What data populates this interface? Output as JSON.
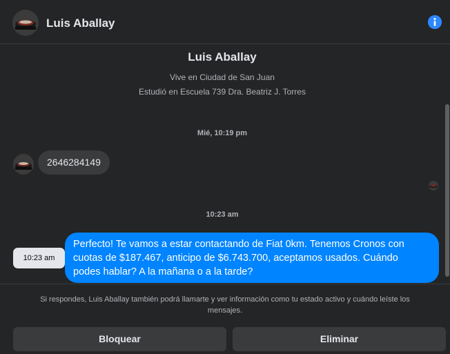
{
  "header": {
    "name": "Luis Aballay",
    "avatar_icon": "profile-photo",
    "info_icon": "info-icon"
  },
  "profile": {
    "name": "Luis Aballay",
    "lives_in": "Vive en Ciudad de San Juan",
    "studied_at": "Estudió en Escuela 739 Dra. Beatriz J. Torres"
  },
  "messages": {
    "timestamp_1": "Mié, 10:19 pm",
    "incoming_text": "2646284149",
    "timestamp_2": "10:23 am",
    "outgoing_line_1": "Perfecto! Te vamos a estar contactando de Fiat 0km. Tenemos Cronos con",
    "outgoing_line_2": "cuotas de $187.467, anticipo de $6.743.700, aceptamos usados. Cuándo",
    "outgoing_line_3": "podes hablar? A la mañana o a la tarde?",
    "outgoing_time_tooltip": "10:23 am"
  },
  "footer": {
    "notice_line_1": "Si respondes, Luis Aballay también podrá llamarte y ver información como tu estado activo y cuándo leíste los",
    "notice_line_2": "mensajes.",
    "block_label": "Bloquear",
    "delete_label": "Eliminar"
  },
  "colors": {
    "background": "#242526",
    "outgoing_bubble": "#0084ff",
    "incoming_bubble": "#3a3b3c",
    "accent": "#2d88ff"
  }
}
